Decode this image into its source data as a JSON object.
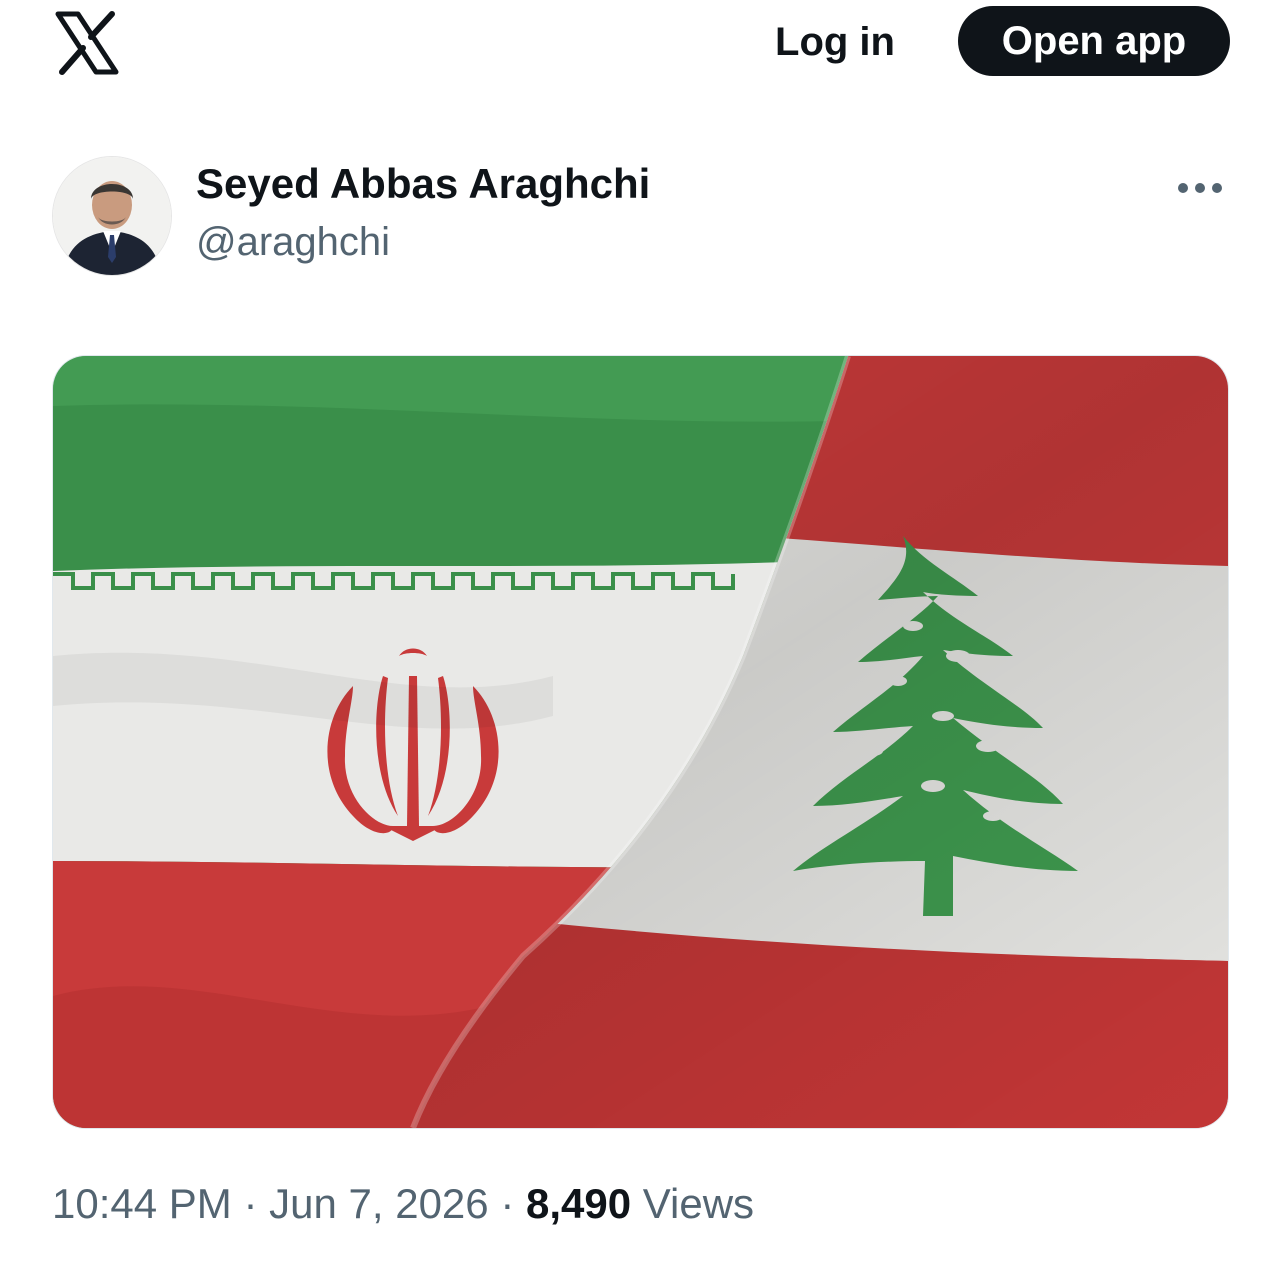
{
  "header": {
    "logo_icon": "x-logo-icon",
    "login_label": "Log in",
    "open_app_label": "Open app"
  },
  "author": {
    "name": "Seyed Abbas Araghchi",
    "handle": "@araghchi",
    "avatar_icon": "avatar-photo",
    "more_icon": "more-horizontal-icon"
  },
  "media": {
    "description_icon": "flags-image",
    "colors": {
      "green": "#3a8f4a",
      "white": "#e9e9e7",
      "red": "#c83a3a",
      "cedar": "#3f9a4f"
    }
  },
  "meta": {
    "time": "10:44 PM",
    "separator": "·",
    "date": "Jun 7, 2026",
    "views_count": "8,490",
    "views_label": "Views"
  }
}
